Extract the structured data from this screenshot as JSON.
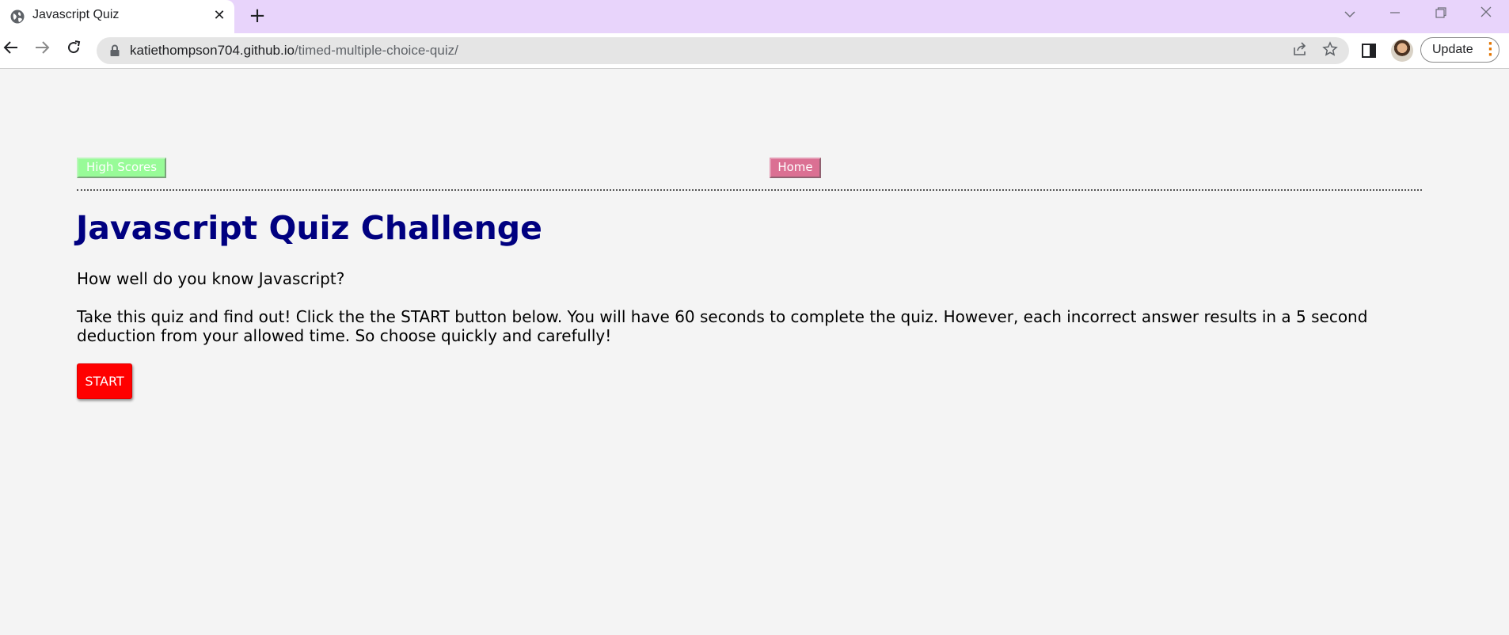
{
  "browser": {
    "tab": {
      "title": "Javascript Quiz",
      "favicon": "globe-icon",
      "close_glyph": "✕"
    },
    "new_tab_glyph": "+",
    "window_controls": [
      "chevron-down-icon",
      "minimize-icon",
      "restore-icon",
      "close-icon"
    ],
    "address_bar": {
      "host": "katiethompson704.github.io",
      "path": "/timed-multiple-choice-quiz/"
    },
    "update_button_label": "Update",
    "colors": {
      "tab_strip": "#e8d4fb",
      "update_menu_dots": "#e37400"
    }
  },
  "page": {
    "nav": {
      "high_scores_label": "High Scores",
      "home_label": "Home"
    },
    "title": "Javascript Quiz Challenge",
    "question": "How well do you know Javascript?",
    "description": "Take this quiz and find out! Click the the START button below. You will have 60 seconds to complete the quiz. However, each incorrect answer results in a 5 second deduction from your allowed time. So choose quickly and carefully!",
    "start_label": "START",
    "colors": {
      "background": "#f4f4f4",
      "high_scores_button": "#98fb98",
      "home_button": "#db7093",
      "title": "#000080",
      "start_button": "#ff0000"
    }
  }
}
